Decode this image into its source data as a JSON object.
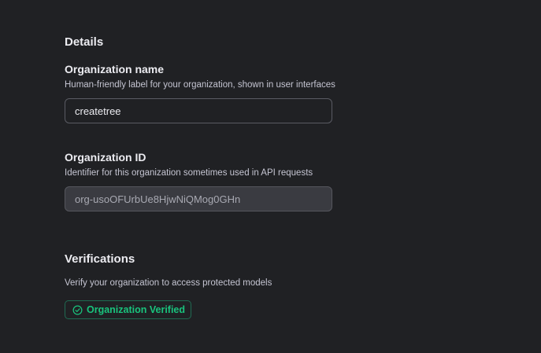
{
  "details": {
    "heading": "Details",
    "org_name": {
      "label": "Organization name",
      "help": "Human-friendly label for your organization, shown in user interfaces",
      "value": "createtree"
    },
    "org_id": {
      "label": "Organization ID",
      "help": "Identifier for this organization sometimes used in API requests",
      "value": "org-usoOFUrbUe8HjwNiQMog0GHn"
    }
  },
  "verifications": {
    "heading": "Verifications",
    "help": "Verify your organization to access protected models",
    "badge": {
      "label": "Organization Verified",
      "icon": "check-circle-icon",
      "color": "#19c37d"
    }
  },
  "colors": {
    "background": "#202124",
    "text": "#ececf1",
    "muted": "#c5c5d2",
    "success": "#19c37d"
  }
}
